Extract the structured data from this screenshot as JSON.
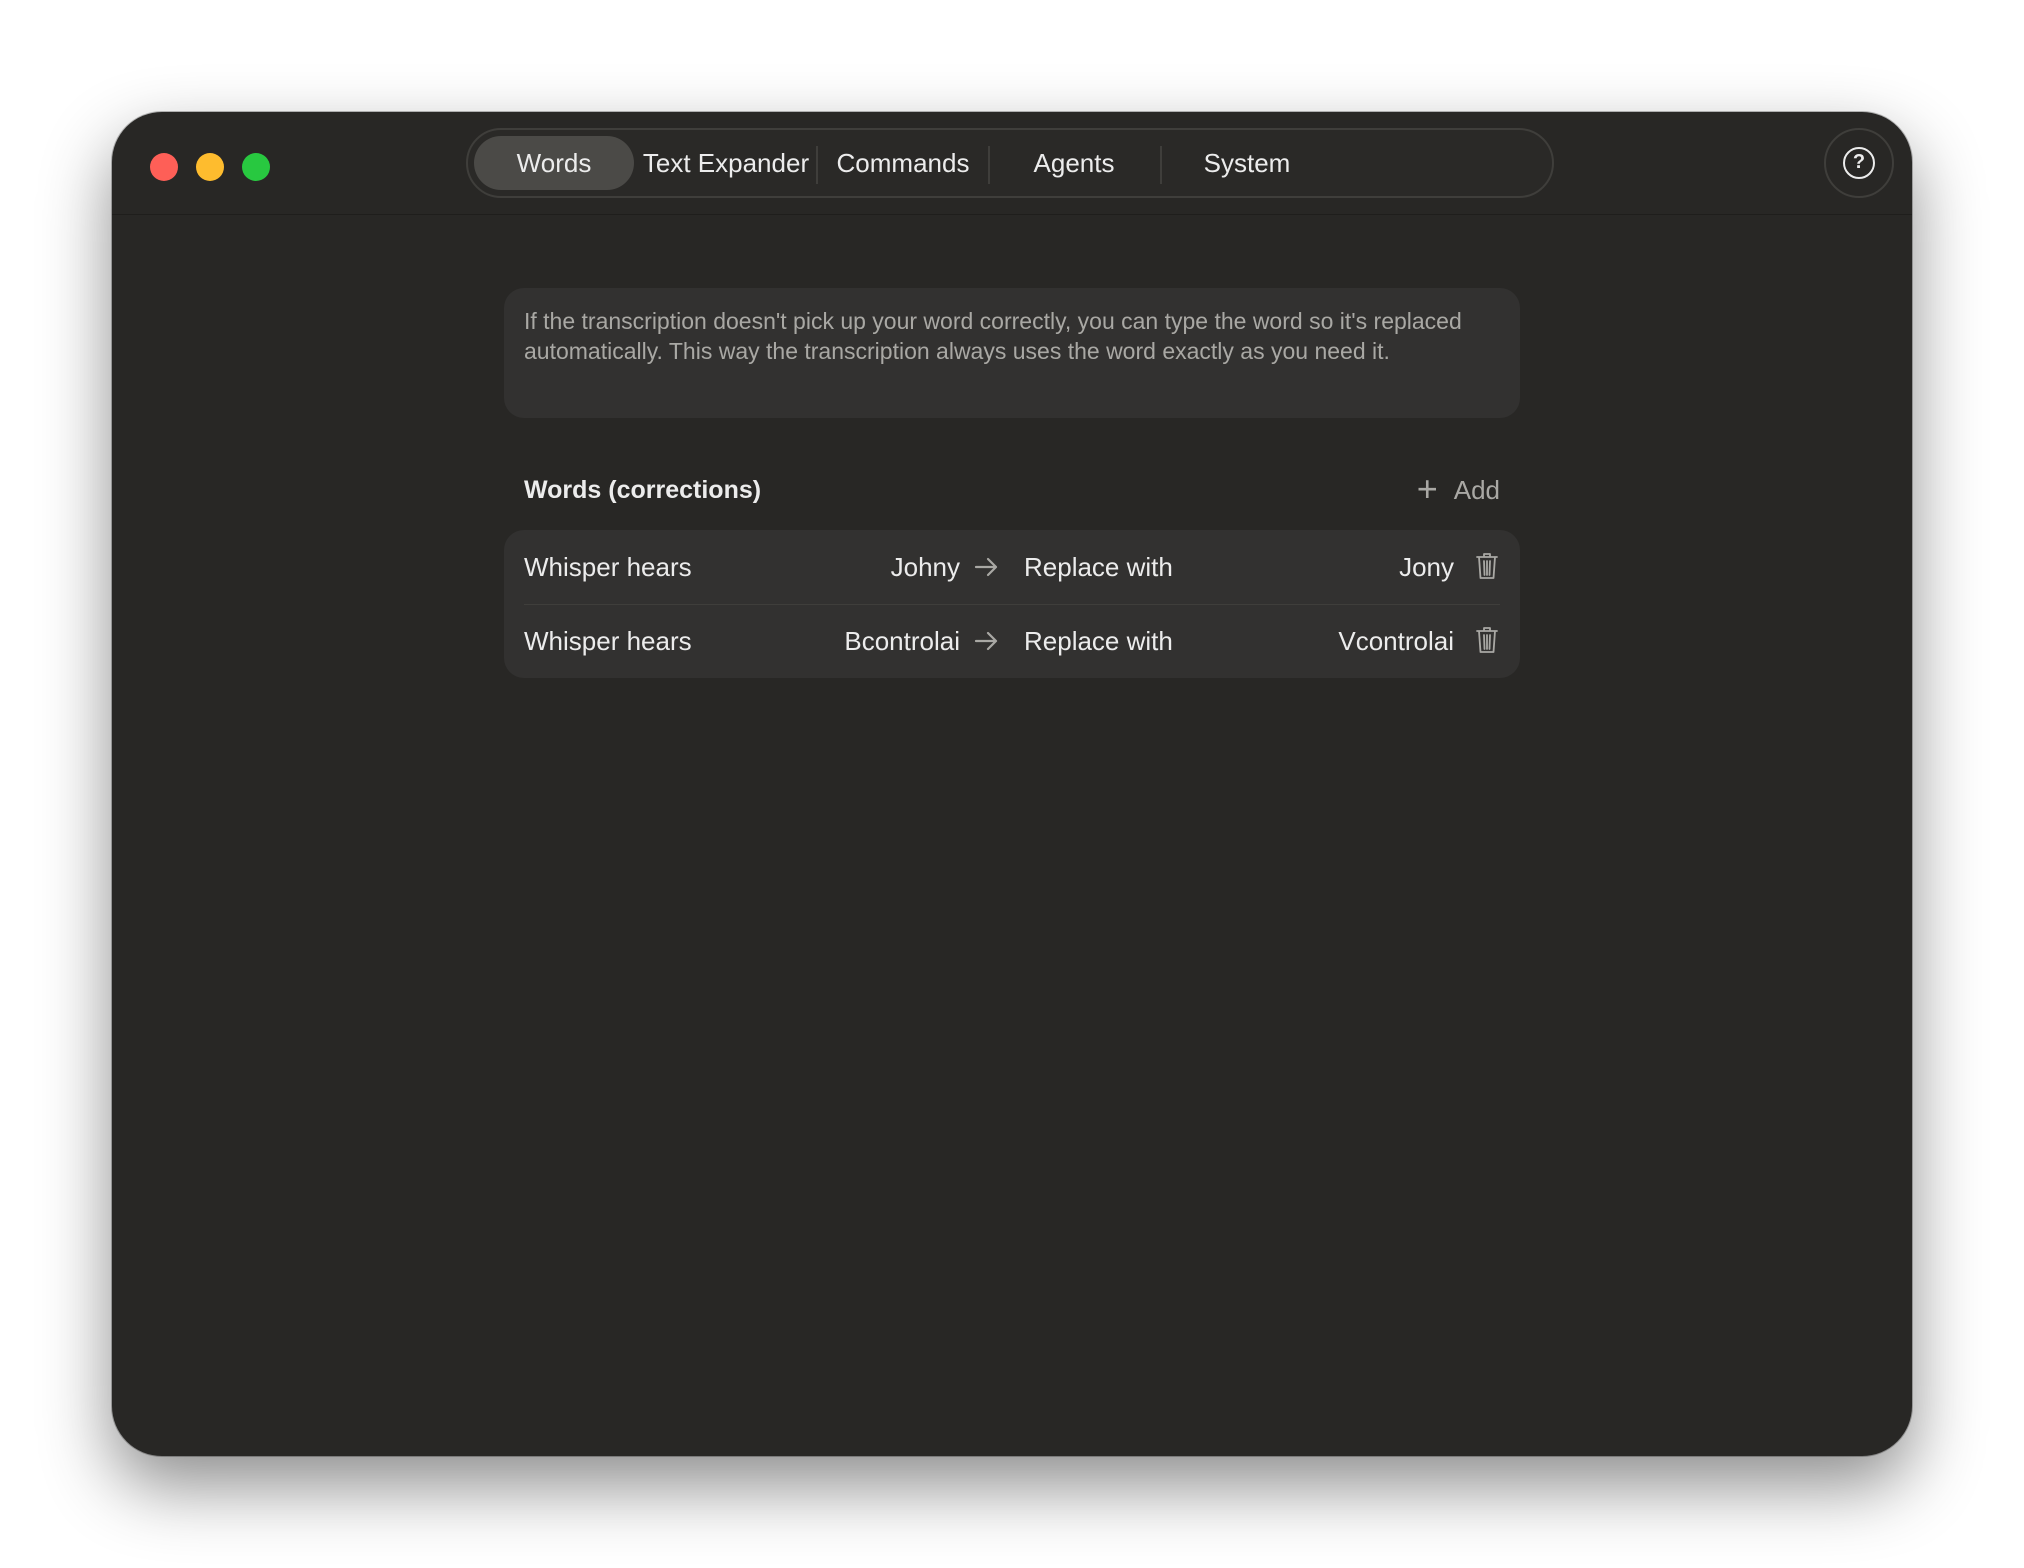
{
  "tabs": [
    {
      "label": "Words",
      "active": true
    },
    {
      "label": "Text Expander",
      "active": false
    },
    {
      "label": "Commands",
      "active": false
    },
    {
      "label": "Agents",
      "active": false
    },
    {
      "label": "System",
      "active": false
    }
  ],
  "help": {
    "icon": "question-circle-icon",
    "glyph": "?"
  },
  "info": {
    "text": "If the transcription doesn't pick up your word correctly, you can type the word so it's replaced automatically. This way the transcription always uses the word exactly as you need it."
  },
  "section": {
    "title": "Words (corrections)",
    "add_label": "Add",
    "add_icon": "plus-icon"
  },
  "corrections": [
    {
      "hears_label": "Whisper hears",
      "heard": "Johny",
      "replace_label": "Replace with",
      "replacement": "Jony"
    },
    {
      "hears_label": "Whisper hears",
      "heard": "Bcontrolai",
      "replace_label": "Replace with",
      "replacement": "Vcontrolai"
    }
  ],
  "colors": {
    "background": "#282725",
    "panel": "#323130",
    "accent_tab": "#4b4a47",
    "text": "#ececec",
    "muted_text": "#a9a8a4",
    "traffic_close": "#fe5f57",
    "traffic_min": "#febc2e",
    "traffic_max": "#28c840"
  }
}
